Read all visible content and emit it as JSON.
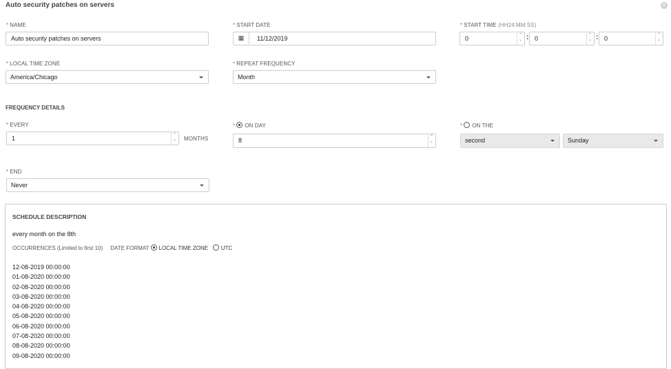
{
  "dialog": {
    "title": "Auto security patches on servers"
  },
  "labels": {
    "required_mark": "*",
    "name": "NAME",
    "start_date": "START DATE",
    "start_time": "START TIME",
    "start_time_hint": "(HH24:MM:SS)",
    "local_time_zone": "LOCAL TIME ZONE",
    "repeat_frequency": "REPEAT FREQUENCY",
    "frequency_details": "FREQUENCY DETAILS",
    "every": "EVERY",
    "every_unit": "MONTHS",
    "on_day": "ON DAY",
    "on_the": "ON THE",
    "end": "END"
  },
  "fields": {
    "name": "Auto security patches on servers",
    "start_date": "11/12/2019",
    "start_hour": "0",
    "start_minute": "0",
    "start_second": "0",
    "local_time_zone": "America/Chicago",
    "repeat_frequency": "Month",
    "every": "1",
    "on_day": "8",
    "on_the_ordinal": "second",
    "on_the_weekday": "Sunday",
    "end": "Never"
  },
  "radios": {
    "on_day_selected": true,
    "on_the_selected": false,
    "date_format": "LOCAL TIME ZONE"
  },
  "schedule": {
    "heading": "SCHEDULE DESCRIPTION",
    "description": "every month on the 8th",
    "occurrences_label": "OCCURRENCES (Limited to first 10)",
    "date_format_label": "DATE FORMAT",
    "date_format_local": "LOCAL TIME ZONE",
    "date_format_utc": "UTC",
    "occurrences": [
      "12-08-2019 00:00:00",
      "01-08-2020 00:00:00",
      "02-08-2020 00:00:00",
      "03-08-2020 00:00:00",
      "04-08-2020 00:00:00",
      "05-08-2020 00:00:00",
      "06-08-2020 00:00:00",
      "07-08-2020 00:00:00",
      "08-08-2020 00:00:00",
      "09-08-2020 00:00:00"
    ]
  },
  "icons": {
    "close": "close-icon",
    "calendar": "calendar-icon",
    "spinner": "spinner-arrows-icon",
    "dropdown": "chevron-down-icon"
  },
  "colors": {
    "required": "#d9534f",
    "border": "#cccccc",
    "grey_select": "#e9e9e9"
  }
}
